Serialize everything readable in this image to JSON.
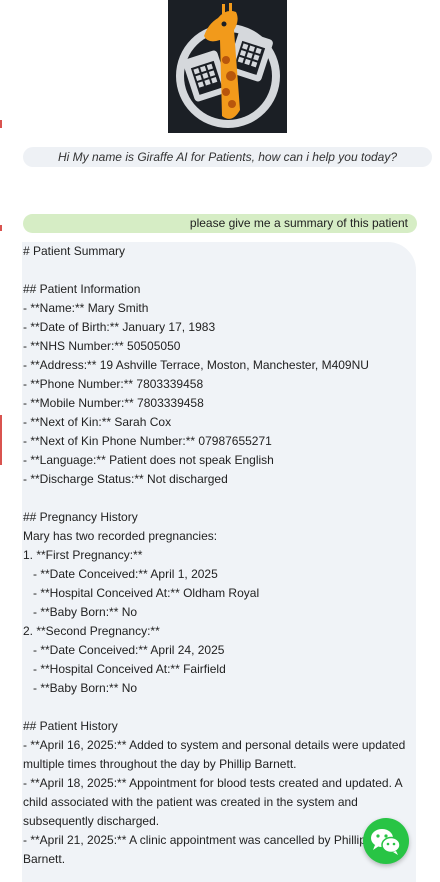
{
  "logo": {
    "icon": "giraffe-calendar-logo",
    "colors": {
      "bg": "#1b1f25",
      "giraffe": "#f29a1b",
      "ring": "#d5d8dc"
    }
  },
  "greeting": "Hi My name is Giraffe AI for Patients, how can i help you today?",
  "user_message": "please give me a summary of this patient",
  "summary": {
    "title": "# Patient Summary",
    "info_heading": "## Patient Information",
    "info": [
      "- **Name:** Mary Smith",
      "- **Date of Birth:** January 17, 1983",
      "- **NHS Number:** 50505050",
      "- **Address:** 19 Ashville Terrace, Moston, Manchester, M409NU",
      "- **Phone Number:** 7803339458",
      "- **Mobile Number:** 7803339458",
      "- **Next of Kin:** Sarah Cox",
      "- **Next of Kin Phone Number:** 07987655271",
      "- **Language:** Patient does not speak English",
      "- **Discharge Status:** Not discharged"
    ],
    "pregnancy_heading": "## Pregnancy History",
    "pregnancy_intro": "Mary has two recorded pregnancies:",
    "pregnancy": [
      "1. **First Pregnancy:**",
      "   - **Date Conceived:** April 1, 2025",
      "   - **Hospital Conceived At:** Oldham Royal",
      "   - **Baby Born:** No",
      "2. **Second Pregnancy:**",
      "   - **Date Conceived:** April 24, 2025",
      "   - **Hospital Conceived At:** Fairfield",
      "   - **Baby Born:** No"
    ],
    "history_heading": "## Patient History",
    "history": [
      "- **April 16, 2025:** Added to system and personal details were updated multiple times throughout the day by Phillip Barnett.",
      "- **April 18, 2025:** Appointment for blood tests created and updated. A child associated with the patient was created in the system and subsequently discharged.",
      "- **April 21, 2025:** A clinic appointment was cancelled by Phillip Barnett."
    ]
  },
  "chat_button": {
    "icon": "wechat-icon",
    "color": "#28c445"
  }
}
